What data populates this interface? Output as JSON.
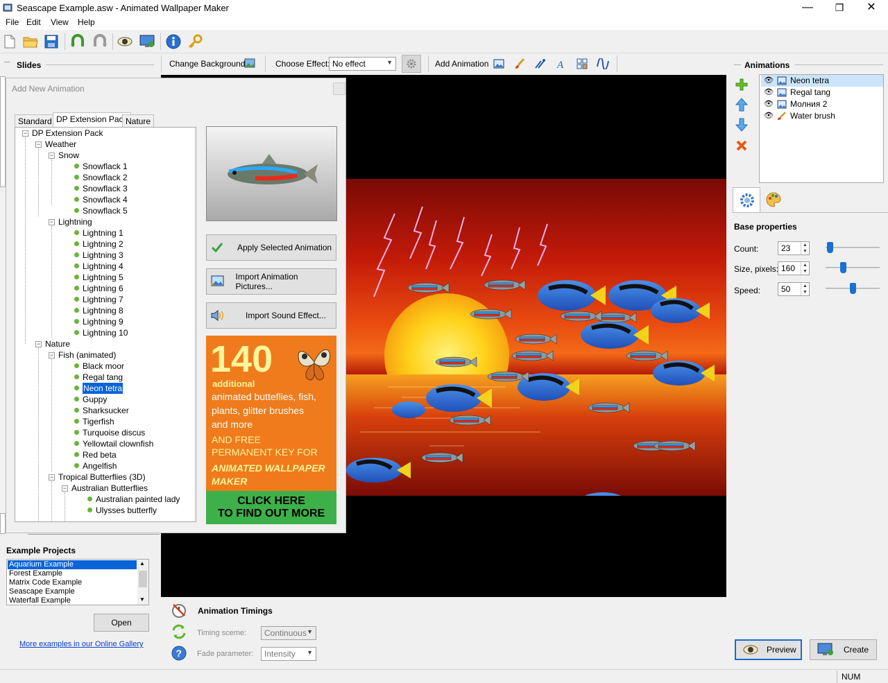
{
  "window": {
    "title": "Seascape Example.asw - Animated Wallpaper Maker",
    "minimize": "—",
    "maximize": "❐",
    "close": "✕"
  },
  "menu": [
    "File",
    "Edit",
    "View",
    "Help"
  ],
  "toolbar_icons": [
    "new-file-icon",
    "open-folder-icon",
    "save-icon",
    "undo-icon",
    "redo-icon",
    "preview-eye-icon",
    "set-wallpaper-icon",
    "info-icon",
    "key-icon"
  ],
  "effects_bar": {
    "change_background": "Change Background",
    "choose_effect_label": "Choose Effect:",
    "choose_effect_value": "No effect",
    "add_animation": "Add Animation"
  },
  "left_panel": {
    "slides_title": "Slides",
    "example_projects_title": "Example Projects",
    "projects": [
      "Aquarium Example",
      "Forest Example",
      "Matrix Code Example",
      "Seascape Example",
      "Waterfall Example"
    ],
    "open_button": "Open",
    "gallery_link": "More examples in our Online Gallery"
  },
  "dialog": {
    "title": "Add New Animation",
    "tabs": [
      "Standard",
      "DP Extension Pack",
      "Nature"
    ],
    "tree": {
      "root": "DP Extension Pack",
      "weather": "Weather",
      "snow": "Snow",
      "snow_items": [
        "Snowflack 1",
        "Snowflack 2",
        "Snowflack 3",
        "Snowflack 4",
        "Snowflack 5"
      ],
      "lightning": "Lightning",
      "lightning_items": [
        "Lightning 1",
        "Lightning 2",
        "Lightning 3",
        "Lightning 4",
        "Lightning 5",
        "Lightning 6",
        "Lightning 7",
        "Lightning 8",
        "Lightning 9",
        "Lightning 10"
      ],
      "nature": "Nature",
      "fish": "Fish (animated)",
      "fish_items": [
        "Black moor",
        "Regal tang",
        "Neon tetra",
        "Guppy",
        "Sharksucker",
        "Tigerfish",
        "Turquoise discus",
        "Yellowtail clownfish",
        "Red beta",
        "Angelfish"
      ],
      "butterflies": "Tropical Butterflies (3D)",
      "australian": "Australian Butterflies",
      "australian_items": [
        "Australian painted lady",
        "Ulysses butterfly"
      ]
    },
    "buttons": {
      "apply": "Apply Selected Animation",
      "import_pictures": "Import Animation Pictures...",
      "import_sound": "Import Sound Effect..."
    },
    "ad": {
      "number": "140",
      "additional": "additional",
      "line1": "animated butteflies, fish,",
      "line2": "plants, glitter brushes",
      "line3": "and more",
      "line4": "AND FREE",
      "line5": "PERMANENT KEY FOR",
      "line6": "ANIMATED WALLPAPER",
      "line7": "MAKER",
      "cta1": "CLICK HERE",
      "cta2": "TO FIND OUT MORE"
    }
  },
  "right_panel": {
    "animations_title": "Animations",
    "animations": [
      {
        "name": "Neon tetra",
        "icon": "picture-icon"
      },
      {
        "name": "Regal tang",
        "icon": "picture-icon"
      },
      {
        "name": "Молния 2",
        "icon": "picture-icon"
      },
      {
        "name": "Water brush",
        "icon": "brush-icon"
      }
    ],
    "base_properties": "Base properties",
    "count_label": "Count:",
    "count_value": "23",
    "count_level": 0.03,
    "size_label": "Size, pixels:",
    "size_value": "160",
    "size_level": 0.3,
    "speed_label": "Speed:",
    "speed_value": "50",
    "speed_level": 0.5
  },
  "timings": {
    "title": "Animation Timings",
    "timing_label": "Timing sceme:",
    "timing_value": "Continuous",
    "fade_label": "Fade parameter:",
    "fade_value": "Intensity"
  },
  "bottom_buttons": {
    "preview": "Preview",
    "create": "Create"
  },
  "status": {
    "num": "NUM"
  },
  "colors": {
    "accent": "#0a64d8",
    "ad_orange": "#f07b1c",
    "ad_green": "#3db04a",
    "link": "#0a3fcf"
  }
}
